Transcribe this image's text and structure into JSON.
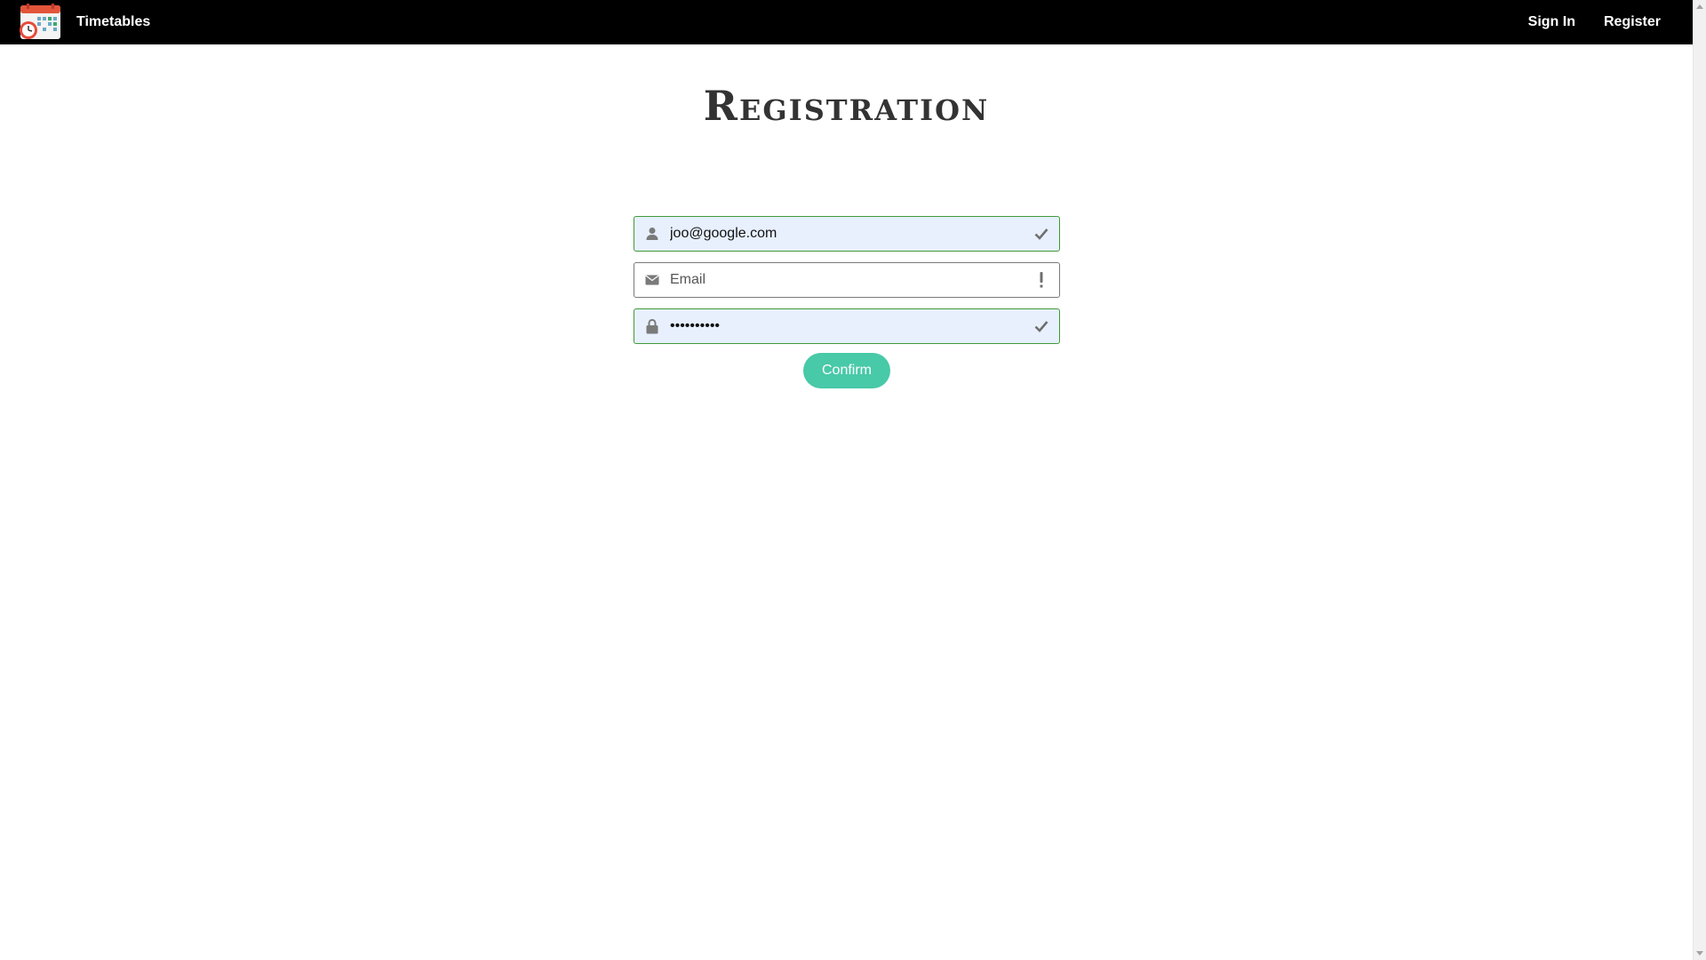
{
  "navbar": {
    "brand": "Timetables",
    "links": [
      {
        "label": "Sign In"
      },
      {
        "label": "Register"
      }
    ]
  },
  "page": {
    "title": "Registration"
  },
  "form": {
    "username": {
      "value": "joo@google.com",
      "placeholder": "",
      "status": "valid"
    },
    "email": {
      "value": "",
      "placeholder": "Email",
      "status": "invalid"
    },
    "password": {
      "value": "••••••••••",
      "status": "valid"
    },
    "confirm_label": "Confirm"
  },
  "colors": {
    "navbar_bg": "#000000",
    "valid_border": "#3e9a3a",
    "autofill_bg": "#e8f0fe",
    "button_bg": "#48c9a8"
  },
  "icons": {
    "logo": "calendar-clock-icon",
    "username": "user-icon",
    "email": "envelope-icon",
    "password": "lock-icon",
    "valid": "check-icon",
    "invalid": "exclamation-icon"
  }
}
